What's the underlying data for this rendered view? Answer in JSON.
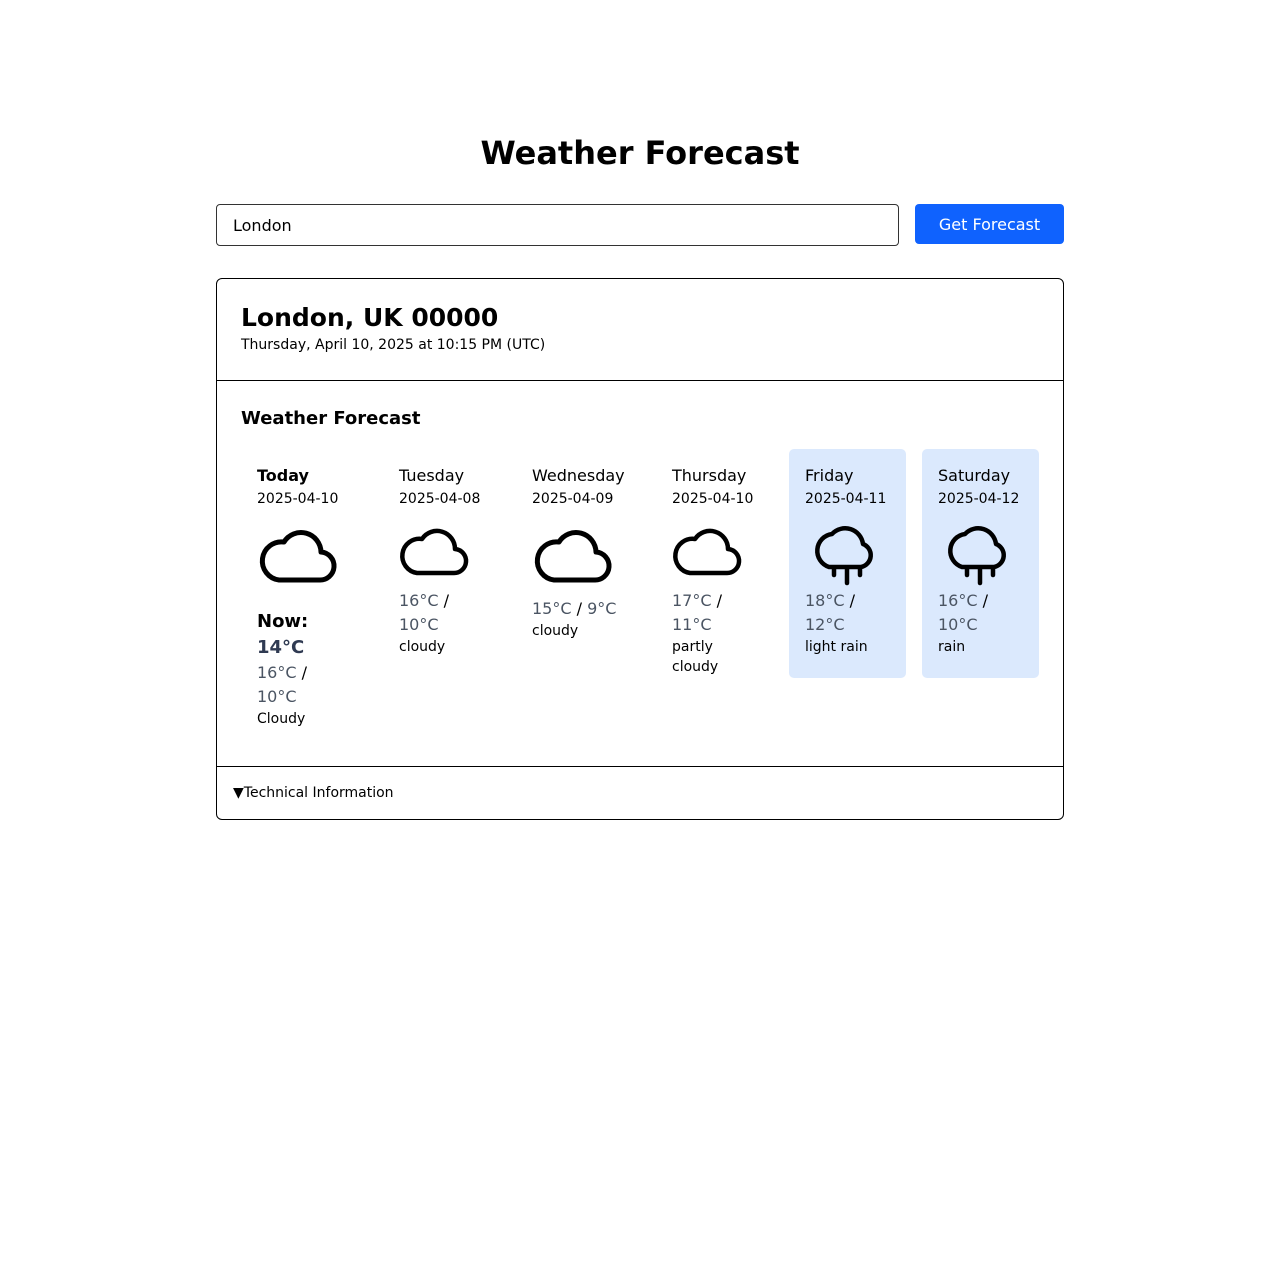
{
  "page": {
    "title": "Weather Forecast"
  },
  "search": {
    "value": "London",
    "button_label": "Get Forecast"
  },
  "location": {
    "name": "London, UK 00000",
    "timestamp": "Thursday, April 10, 2025 at 10:15 PM (UTC)"
  },
  "forecast": {
    "title": "Weather Forecast",
    "now_label": "Now:",
    "now_temp": "14°C",
    "days": [
      {
        "name": "Today",
        "date": "2025-04-10",
        "high": "16°C",
        "low": "10°C",
        "condition": "Cloudy",
        "icon": "cloud-icon",
        "highlighted": false
      },
      {
        "name": "Tuesday",
        "date": "2025-04-08",
        "high": "16°C",
        "low": "10°C",
        "condition": "cloudy",
        "icon": "cloud-icon",
        "highlighted": false
      },
      {
        "name": "Wednesday",
        "date": "2025-04-09",
        "high": "15°C",
        "low": "9°C",
        "condition": "cloudy",
        "icon": "cloud-icon",
        "highlighted": false
      },
      {
        "name": "Thursday",
        "date": "2025-04-10",
        "high": "17°C",
        "low": "11°C",
        "condition": "partly cloudy",
        "icon": "cloud-icon",
        "highlighted": false
      },
      {
        "name": "Friday",
        "date": "2025-04-11",
        "high": "18°C",
        "low": "12°C",
        "condition": "light rain",
        "icon": "rain-cloud-icon",
        "highlighted": true
      },
      {
        "name": "Saturday",
        "date": "2025-04-12",
        "high": "16°C",
        "low": "10°C",
        "condition": "rain",
        "icon": "rain-cloud-icon",
        "highlighted": true
      }
    ]
  },
  "details": {
    "toggle_icon": "▼",
    "label": "Technical Information"
  },
  "colors": {
    "accent": "#0f62fe",
    "highlight": "#dbe9fd",
    "temp_text": "#4b5563"
  }
}
